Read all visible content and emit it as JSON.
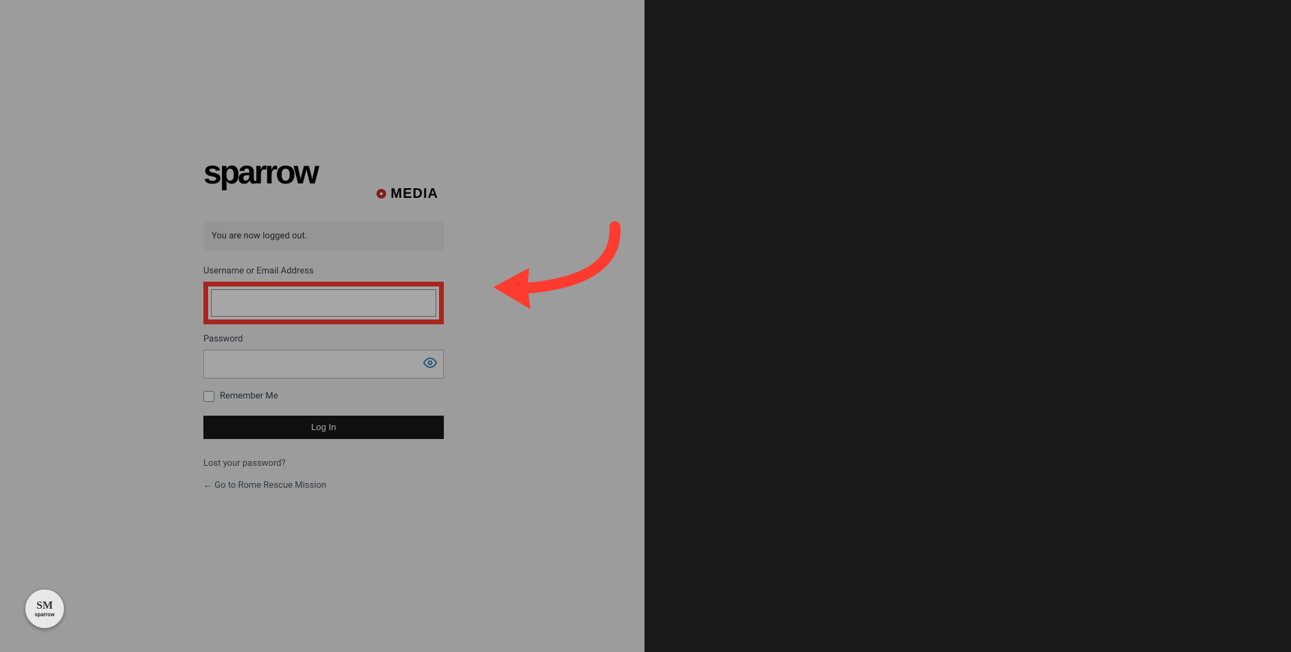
{
  "logo": {
    "brand": "sparrow",
    "subbrand": "MEDIA"
  },
  "message": "You are now logged out.",
  "labels": {
    "username": "Username or Email Address",
    "password": "Password",
    "remember": "Remember Me"
  },
  "buttons": {
    "login": "Log In"
  },
  "links": {
    "lost_password": "Lost your password?",
    "go_back": "← Go to Rome Rescue Mission"
  },
  "badge": {
    "top": "SM",
    "bottom": "sparrow"
  },
  "colors": {
    "highlight": "#ff3b30",
    "dark_panel": "#1a1a1a",
    "overlay": "rgba(0,0,0,0.35)"
  }
}
